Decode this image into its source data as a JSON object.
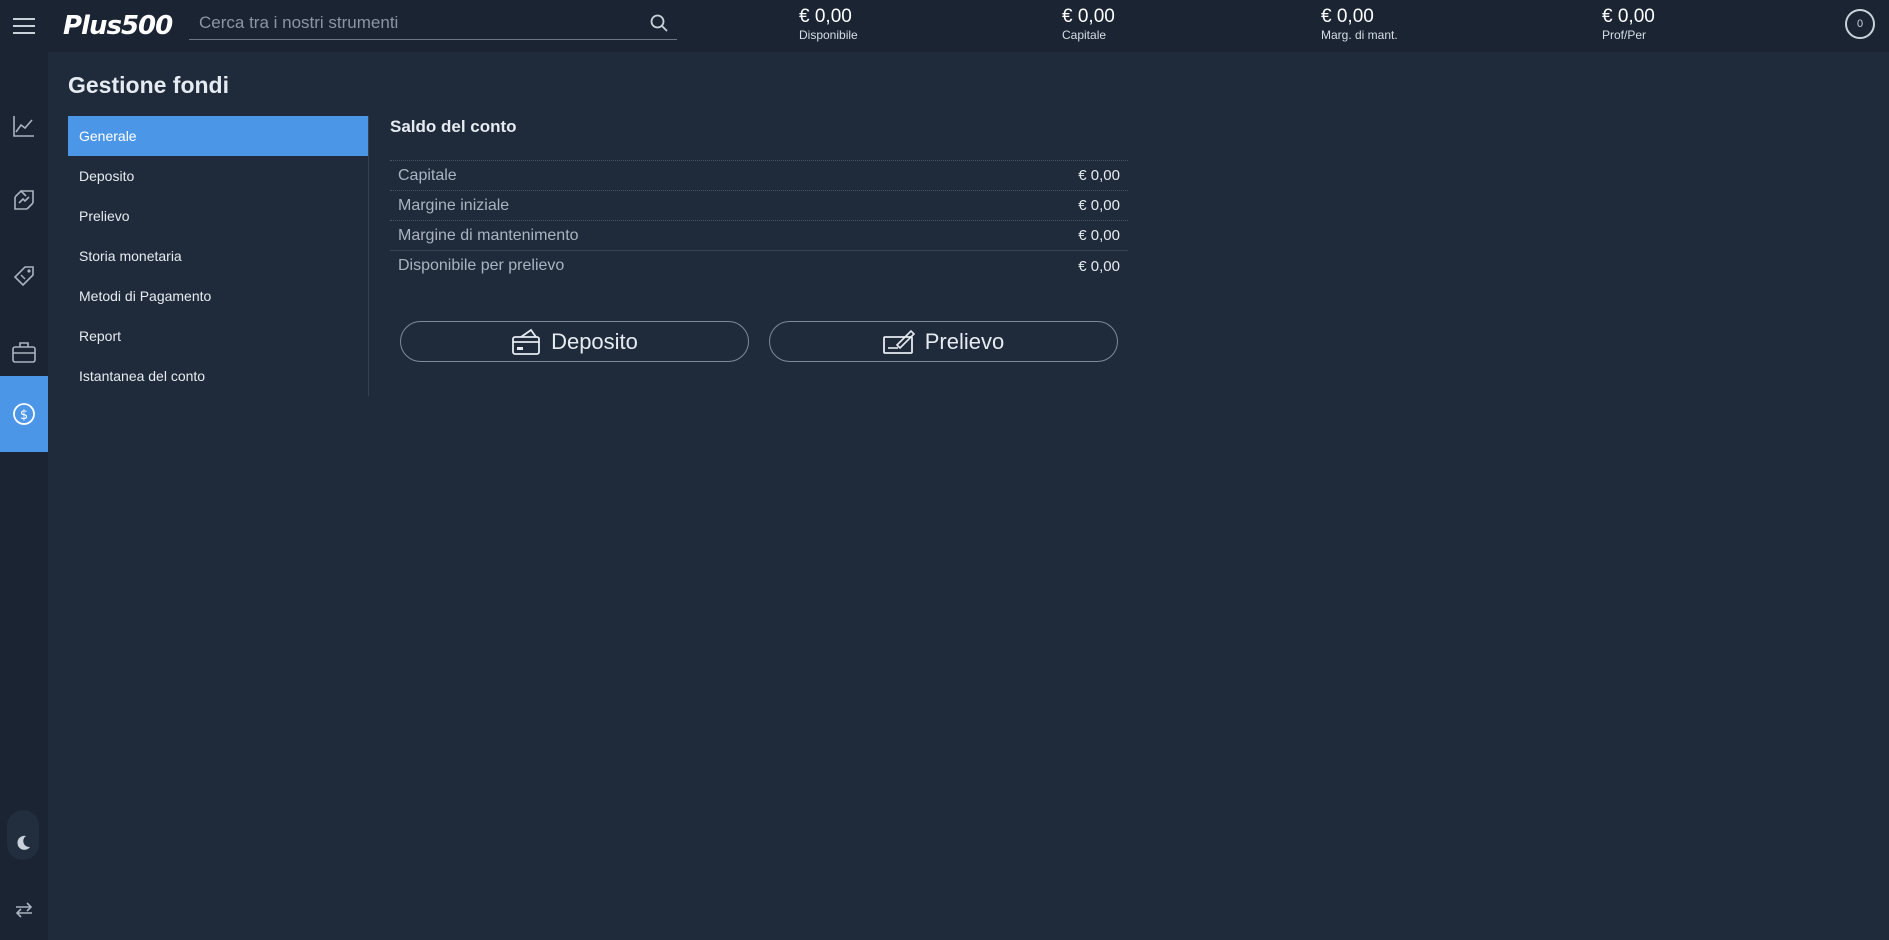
{
  "app": {
    "logo_text": "Plus500"
  },
  "search": {
    "placeholder": "Cerca tra i nostri strumenti"
  },
  "stats": [
    {
      "value": "€ 0,00",
      "label": "Disponibile"
    },
    {
      "value": "€ 0,00",
      "label": "Capitale"
    },
    {
      "value": "€ 0,00",
      "label": "Marg. di mant."
    },
    {
      "value": "€ 0,00",
      "label": "Prof/Per"
    }
  ],
  "user": {
    "badge": "0"
  },
  "rail": {
    "items": [
      "chart-line-icon",
      "trade-arrows-icon",
      "tag-icon",
      "briefcase-icon",
      "dollar-circle-icon"
    ],
    "active": "dollar-circle-icon",
    "bottom": [
      "moon-icon",
      "switch-arrows-icon"
    ]
  },
  "page": {
    "title": "Gestione fondi"
  },
  "subnav": {
    "items": [
      {
        "label": "Generale",
        "active": true
      },
      {
        "label": "Deposito"
      },
      {
        "label": "Prelievo"
      },
      {
        "label": "Storia monetaria"
      },
      {
        "label": "Metodi di Pagamento"
      },
      {
        "label": "Report"
      },
      {
        "label": "Istantanea del conto"
      }
    ]
  },
  "balance": {
    "title": "Saldo del conto",
    "rows": [
      {
        "label": "Capitale",
        "value": "€ 0,00"
      },
      {
        "label": "Margine iniziale",
        "value": "€ 0,00"
      },
      {
        "label": "Margine di mantenimento",
        "value": "€ 0,00"
      },
      {
        "label": "Disponibile per prelievo",
        "value": "€ 0,00"
      }
    ]
  },
  "actions": {
    "deposit_label": "Deposito",
    "withdraw_label": "Prelievo"
  },
  "colors": {
    "background": "#1f2b3a",
    "topbar": "#1a2432",
    "accent": "#4c96e8"
  }
}
